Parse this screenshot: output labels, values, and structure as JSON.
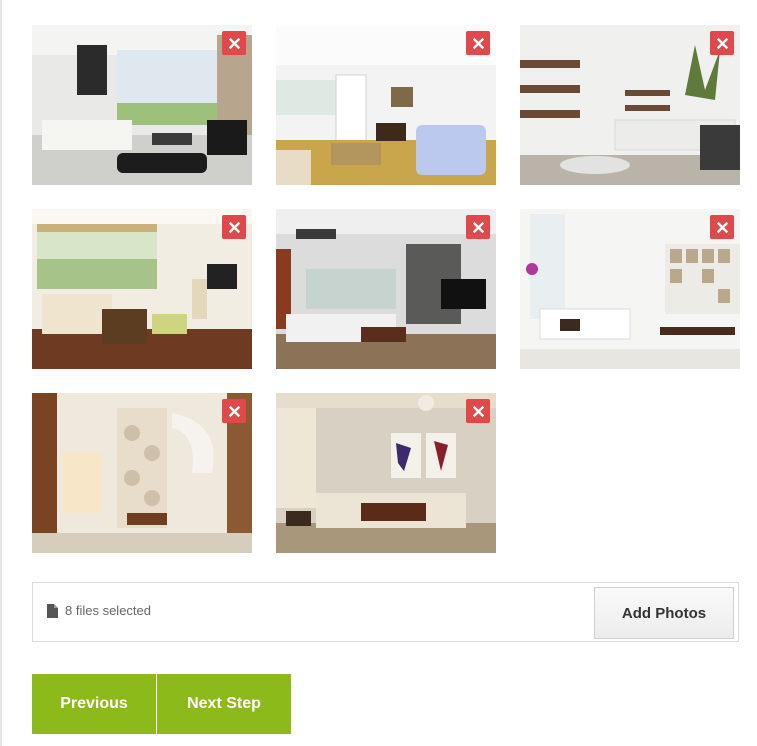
{
  "photos": [
    {
      "alt": "Living room 1"
    },
    {
      "alt": "Living room 2"
    },
    {
      "alt": "Living room 3"
    },
    {
      "alt": "Living room 4"
    },
    {
      "alt": "Living room 5"
    },
    {
      "alt": "Living room 6"
    },
    {
      "alt": "Living room 7"
    },
    {
      "alt": "Living room 8"
    }
  ],
  "remove_icon": "close-icon",
  "remove_color": "#e0484a",
  "file_bar": {
    "status_text": "8 files selected",
    "icon": "file-icon",
    "add_button_label": "Add Photos"
  },
  "navigation": {
    "previous_label": "Previous",
    "next_label": "Next Step",
    "accent_color": "#8cba1a"
  }
}
